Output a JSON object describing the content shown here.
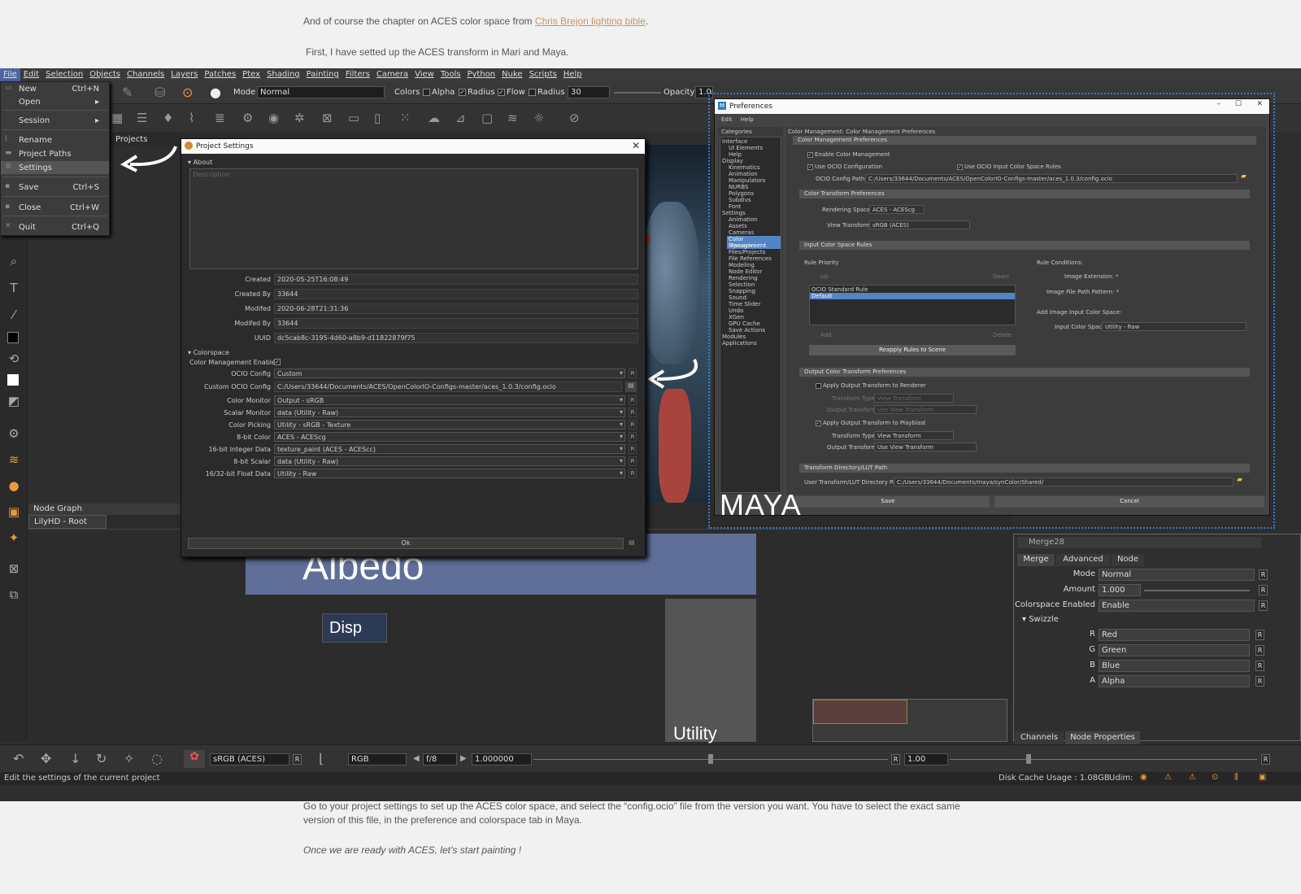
{
  "blog": {
    "line1_pre": "And of course the chapter on ACES color space from ",
    "line1_link": "Chris Brejon lighting bible",
    "line1_post": ".",
    "line2": "First, I have setted up the ACES transform in Mari and Maya.",
    "bottom_line1": "Go to your project settings to set up the ACES color space, and select the “config.ocio” file from the version you want. You have to select the exact same",
    "bottom_line2": "version of this file, in the preference and colorspace tab in Maya.",
    "bottom_line3": "Once we are ready with ACES, let’s start painting !"
  },
  "menubar": [
    "File",
    "Edit",
    "Selection",
    "Objects",
    "Channels",
    "Layers",
    "Patches",
    "Ptex",
    "Shading",
    "Painting",
    "Filters",
    "Camera",
    "View",
    "Tools",
    "Python",
    "Nuke",
    "Scripts",
    "Help"
  ],
  "toolbar": {
    "mode_label": "Mode",
    "mode_value": "Normal",
    "colors_label": "Colors",
    "alpha_label": "Alpha",
    "radius_label": "Radius",
    "flow_label": "Flow",
    "radius2_label": "Radius",
    "radius_value": "30",
    "opacity_label": "Opacity",
    "opacity_value": "1.000"
  },
  "file_menu": {
    "items": [
      {
        "label": "New",
        "shortcut": "Ctrl+N"
      },
      {
        "label": "Open",
        "shortcut": "▸"
      },
      {
        "label": "Session",
        "shortcut": "▸"
      },
      {
        "label": "Rename",
        "shortcut": ""
      },
      {
        "label": "Project Paths",
        "shortcut": ""
      },
      {
        "label": "Settings",
        "shortcut": ""
      },
      {
        "label": "Save",
        "shortcut": "Ctrl+S"
      },
      {
        "label": "Close",
        "shortcut": "Ctrl+W"
      },
      {
        "label": "Quit",
        "shortcut": "Ctrl+Q"
      }
    ]
  },
  "projects_tab": "Projects",
  "project_settings": {
    "title": "Project Settings",
    "about_label": "About",
    "description_placeholder": "Description",
    "created_label": "Created",
    "created_value": "2020-05-25T16:08:49",
    "created_by_label": "Created By",
    "created_by_value": "33644",
    "modified_label": "Modifed",
    "modified_value": "2020-06-28T21:31:36",
    "modified_by_label": "Modifed By",
    "modified_by_value": "33644",
    "uuid_label": "UUID",
    "uuid_value": "dc5cab8c-3195-4d60-a8b9-d11822879f75",
    "colorspace_label": "Colorspace",
    "cm_enabled_label": "Color Management Enabled",
    "ocio_config_label": "OCIO Config",
    "ocio_config_value": "Custom",
    "custom_ocio_label": "Custom OCIO Config",
    "custom_ocio_value": "C:/Users/33644/Documents/ACES/OpenColorIO-Configs-master/aces_1.0.3/config.ocio",
    "color_monitor_label": "Color Monitor",
    "color_monitor_value": "Output - sRGB",
    "scalar_monitor_label": "Scalar Monitor",
    "scalar_monitor_value": "data (Utility - Raw)",
    "color_picking_label": "Color Picking",
    "color_picking_value": "Utility - sRGB - Texture",
    "bit8_color_label": "8-bit Color",
    "bit8_color_value": "ACES - ACEScg",
    "bit16_int_label": "16-bit Integer Data",
    "bit16_int_value": "texture_paint (ACES - ACEScc)",
    "bit8_scalar_label": "8-bit Scalar",
    "bit8_scalar_value": "data (Utility - Raw)",
    "bit1632_float_label": "16/32-bit Float Data",
    "bit1632_float_value": "Utility - Raw",
    "ok_label": "Ok",
    "r": "R"
  },
  "prefs": {
    "title": "Preferences",
    "menu_edit": "Edit",
    "menu_help": "Help",
    "categories_label": "Categories",
    "categories": [
      "Interface",
      "UI Elements",
      "Help",
      "Display",
      "Kinematics",
      "Animation",
      "Manipulators",
      "NURBS",
      "Polygons",
      "Subdivs",
      "Font",
      "Settings",
      "Animation",
      "Assets",
      "Cameras",
      "Color Management",
      "Dynamics",
      "Files/Projects",
      "File References",
      "Modeling",
      "Node Editor",
      "Rendering",
      "Selection",
      "Snapping",
      "Sound",
      "Time Slider",
      "Undo",
      "XGen",
      "GPU Cache",
      "Save Actions",
      "Modules",
      "Applications"
    ],
    "header": "Color Management: Color Management Preferences",
    "sec_cm": "Color Management Preferences",
    "enable_cm": "Enable Color Management",
    "use_ocio": "Use OCIO Configuration",
    "use_ocio_rules": "Use OCIO Input Color Space Rules",
    "ocio_path_label": "OCIO Config Path:",
    "ocio_path_value": "C:/Users/33644/Documents/ACES/OpenColorIO-Configs-master/aces_1.0.3/config.ocio",
    "sec_ct": "Color Transform Preferences",
    "rendering_space_label": "Rendering Space:",
    "rendering_space_value": "ACES - ACEScg",
    "view_transform_label": "View Transform:",
    "view_transform_value": "sRGB (ACES)",
    "sec_icsr": "Input Color Space Rules",
    "rule_priority": "Rule Priority",
    "up": "Up",
    "down": "Down",
    "rule1": "OCIO Standard Rule",
    "rule2": "Default",
    "add": "Add",
    "delete": "Delete",
    "reapply": "Reapply Rules to Scene",
    "rule_conditions": "Rule Conditions:",
    "image_ext": "Image Extension: *",
    "image_fpp": "Image File Path Pattern: *",
    "add_input_cs": "Add Image Input Color Space:",
    "input_cs_label": "Input Color Space:",
    "input_cs_value": "Utility - Raw",
    "sec_oct": "Output Color Transform Preferences",
    "apply_renderer": "Apply Output Transform to Renderer",
    "transform_type_label": "Transform Type:",
    "transform_type_dim": "View Transform",
    "output_transform_label": "Output Transform:",
    "output_transform_dim": "Use View Transform",
    "apply_playblast": "Apply Output Transform to Playblast",
    "transform_type_value": "View Transform",
    "output_transform_value": "Use View Transform",
    "sec_tdl": "Transform Directory/LUT Path",
    "user_dir_label": "User Transform/LUT Directory Path:",
    "user_dir_value": "C:/Users/33644/Documents/maya/synColor/Shared/",
    "save": "Save",
    "cancel": "Cancel",
    "maya_label": "MAYA"
  },
  "node_graph": {
    "title": "Node Graph",
    "tab": "LilyHD - Root",
    "albedo": "Albedo",
    "disp": "Disp",
    "utility": "Utility"
  },
  "props": {
    "title": "Merge28",
    "tabs": [
      "Merge",
      "Advanced",
      "Node"
    ],
    "mode_label": "Mode",
    "mode_value": "Normal",
    "amount_label": "Amount",
    "amount_value": "1.000",
    "cs_label": "Colorspace Enabled",
    "cs_value": "Enable",
    "swizzle_label": "Swizzle",
    "r_label": "R",
    "r_value": "Red",
    "g_label": "G",
    "g_value": "Green",
    "b_label": "B",
    "b_value": "Blue",
    "a_label": "A",
    "a_value": "Alpha",
    "rbtn": "R"
  },
  "bottom_tabs": [
    "Channels",
    "Node Properties"
  ],
  "bottombar": {
    "cs_value": "sRGB (ACES)",
    "rgb_value": "RGB",
    "fstop": "f/8",
    "exposure": "1.000000",
    "gamma": "1.00",
    "r": "R"
  },
  "status": {
    "left": "Edit the settings of the current project",
    "disk": "Disk Cache Usage : 1.08GB",
    "udim": "Udim:"
  }
}
